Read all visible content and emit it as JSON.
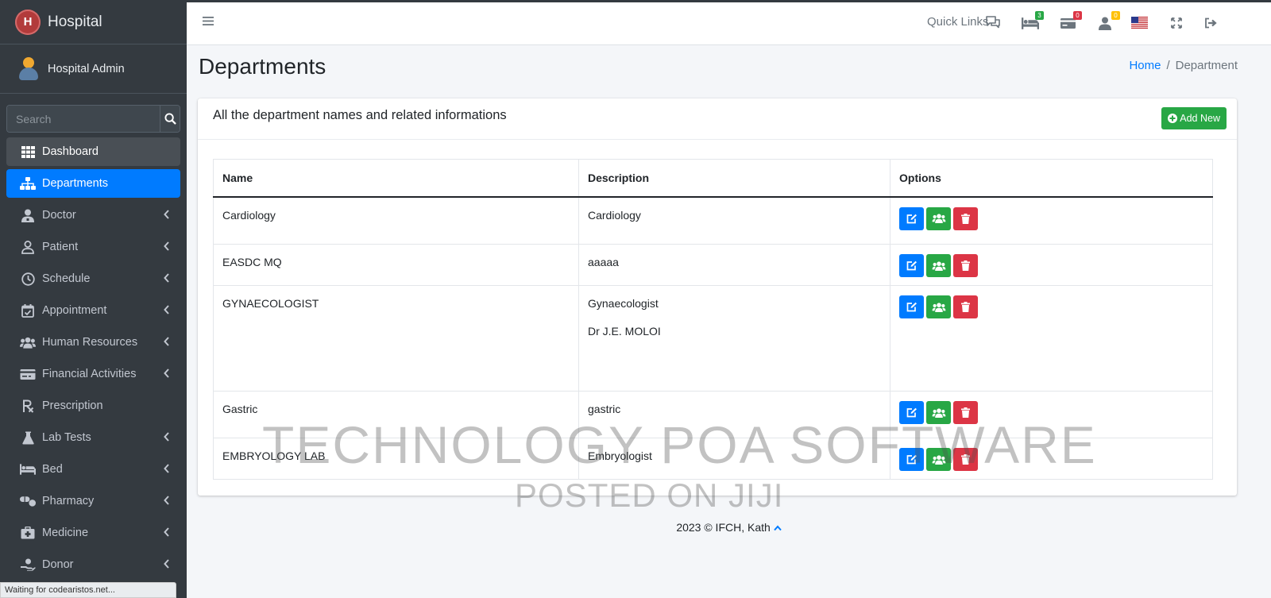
{
  "brand": {
    "name": "Hospital"
  },
  "user": {
    "name": "Hospital Admin"
  },
  "search": {
    "placeholder": "Search"
  },
  "sidebar": {
    "items": [
      {
        "label": "Dashboard",
        "icon": "grid-icon"
      },
      {
        "label": "Departments",
        "icon": "sitemap-icon"
      },
      {
        "label": "Doctor",
        "icon": "user-md-icon"
      },
      {
        "label": "Patient",
        "icon": "user-icon"
      },
      {
        "label": "Schedule",
        "icon": "clock-icon"
      },
      {
        "label": "Appointment",
        "icon": "calendar-check-icon"
      },
      {
        "label": "Human Resources",
        "icon": "users-icon"
      },
      {
        "label": "Financial Activities",
        "icon": "money-icon"
      },
      {
        "label": "Prescription",
        "icon": "prescription-icon"
      },
      {
        "label": "Lab Tests",
        "icon": "flask-icon"
      },
      {
        "label": "Bed",
        "icon": "bed-icon"
      },
      {
        "label": "Pharmacy",
        "icon": "pills-icon"
      },
      {
        "label": "Medicine",
        "icon": "medkit-icon"
      },
      {
        "label": "Donor",
        "icon": "donor-icon"
      }
    ]
  },
  "status_bar": {
    "text": "Waiting for codearistos.net..."
  },
  "navbar": {
    "quick_links": "Quick Links",
    "badges": {
      "bed": "3",
      "payment": "0",
      "patient": "0"
    },
    "colors": {
      "bed_badge": "#28a745",
      "payment_badge": "#dc3545",
      "patient_badge": "#ffc107"
    }
  },
  "page": {
    "title": "Departments",
    "breadcrumb": {
      "home": "Home",
      "sep": "/",
      "current": "Department"
    }
  },
  "card": {
    "title": "All the department names and related informations",
    "add_button": "Add New"
  },
  "table": {
    "headers": {
      "name": "Name",
      "description": "Description",
      "options": "Options"
    },
    "rows": [
      {
        "name": "Cardiology",
        "description": [
          "Cardiology"
        ]
      },
      {
        "name": "EASDC MQ",
        "description": [
          "aaaaa"
        ]
      },
      {
        "name": "GYNAECOLOGIST",
        "description": [
          "Gynaecologist",
          "Dr J.E. MOLOI"
        ]
      },
      {
        "name": "Gastric",
        "description": [
          "gastric"
        ]
      },
      {
        "name": "EMBRYOLOGY LAB",
        "description": [
          "Embryologist"
        ]
      }
    ]
  },
  "footer": {
    "text": "2023 © IFCH, Kath"
  },
  "watermark": {
    "line1": "TECHNOLOGY POA SOFTWARE",
    "line2": "POSTED ON JIJI"
  },
  "colors": {
    "primary": "#007bff",
    "success": "#28a745",
    "danger": "#dc3545",
    "sidebar_bg": "#343a40"
  }
}
